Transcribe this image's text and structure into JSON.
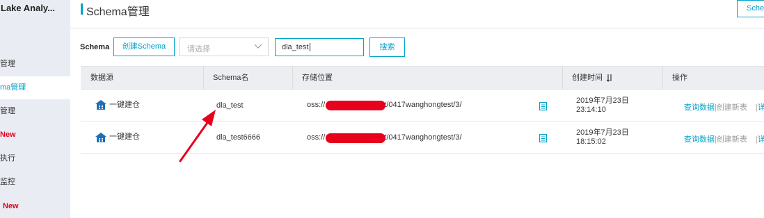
{
  "sidebar": {
    "app_title": "Lake Analy...",
    "items": [
      {
        "label": "管理"
      },
      {
        "label": "ma管理"
      },
      {
        "label": "管理"
      },
      {
        "label": "New"
      },
      {
        "label": "执行"
      },
      {
        "label": "监控"
      },
      {
        "label": "New"
      }
    ]
  },
  "header": {
    "title": "Schema管理",
    "top_button_label": "Sche"
  },
  "filter": {
    "label": "Schema",
    "create_button": "创建Schema",
    "select_placeholder": "请选择",
    "search_value": "dla_test",
    "search_button": "搜索"
  },
  "table": {
    "columns": [
      "数据源",
      "Schema名",
      "存储位置",
      "创建时间",
      "操作"
    ],
    "rows": [
      {
        "source": "一键建仓",
        "schema": "dla_test",
        "location_prefix": "oss://",
        "location_suffix": "t/0417wanghongtest/3/",
        "date": "2019年7月23日",
        "time": "23:14:10",
        "action_query": "查询数据",
        "action_create": "创建新表",
        "action_more": "详"
      },
      {
        "source": "一键建仓",
        "schema": "dla_test6666",
        "location_prefix": "oss://",
        "location_suffix": "t/0417wanghongtest/3/",
        "date": "2019年7月23日",
        "time": "18:15:02",
        "action_query": "查询数据",
        "action_create": "创建新表",
        "action_more": "详"
      }
    ]
  },
  "colors": {
    "accent": "#00a2ca",
    "redaction": "#e8001c",
    "new_badge": "#e8001c",
    "sidebar_bg": "#e9ecf3",
    "table_header_bg": "#eceef2"
  }
}
